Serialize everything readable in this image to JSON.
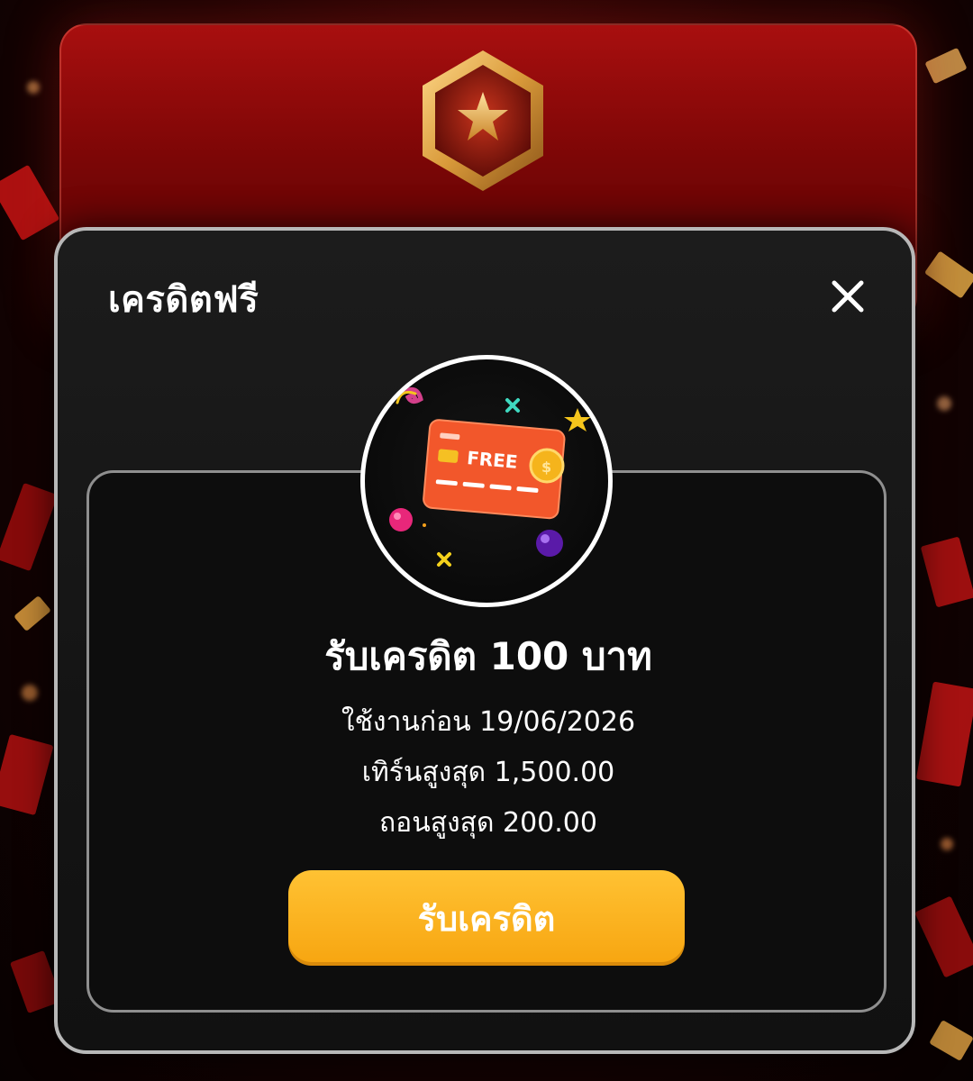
{
  "modal": {
    "title": "เครดิตฟรี",
    "card_image_label": "FREE"
  },
  "reward": {
    "headline": "รับเครดิต 100 บาท",
    "use_before": "ใช้งานก่อน 19/06/2026",
    "max_turnover": "เทิร์นสูงสุด 1,500.00",
    "max_withdraw": "ถอนสูงสุด 200.00"
  },
  "actions": {
    "claim_label": "รับเครดิต"
  },
  "colors": {
    "accent": "#f9ae14",
    "panel_red": "#8a0808",
    "modal_bg": "#151515"
  },
  "icons": {
    "close": "close-icon",
    "badge": "star-hexagon-badge-icon",
    "card": "free-credit-card-icon"
  }
}
